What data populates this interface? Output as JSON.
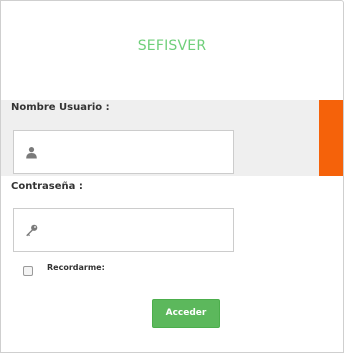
{
  "app": {
    "title": "SEFISVER"
  },
  "form": {
    "username_label": "Nombre Usuario :",
    "username_value": "",
    "password_label": "Contraseña :",
    "password_value": "",
    "remember_label": "Recordarme:",
    "remember_checked": false,
    "submit_label": "Acceder"
  },
  "icons": {
    "username": "user-icon",
    "password": "key-icon"
  },
  "colors": {
    "title": "#6fcf7a",
    "accent_bar": "#f5620a",
    "button": "#5cb85c",
    "band": "#efefef"
  }
}
